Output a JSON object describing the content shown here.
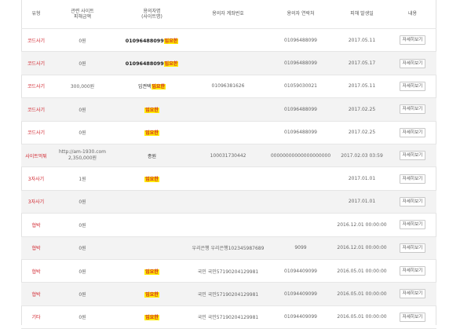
{
  "headers": {
    "type": "유형",
    "site_line1": "관련 사이트",
    "site_line2": "피해금액",
    "suspect_line1": "용의자명",
    "suspect_line2": "(사이트명)",
    "account": "용의자 계좌번호",
    "contact": "용의자 연락처",
    "date": "피해 발생일",
    "detail": "내용"
  },
  "detail_button": "자세히보기",
  "rows": [
    {
      "type": "코드사기",
      "site": "0원",
      "site_extra": "",
      "name": "01096488099",
      "name_mark": "임요한",
      "account": "",
      "contact": "01096488099",
      "date": "2017.05.11"
    },
    {
      "type": "코드사기",
      "site": "0원",
      "site_extra": "",
      "name": "01096488099",
      "name_mark": "임요한",
      "account": "",
      "contact": "01096488099",
      "date": "2017.05.17"
    },
    {
      "type": "코드사기",
      "site": "300,000원",
      "site_extra": "",
      "name": "임권택",
      "name_mark": "임요한",
      "account": "01096381626",
      "contact": "01059030021",
      "date": "2017.05.11"
    },
    {
      "type": "코드사기",
      "site": "0원",
      "site_extra": "",
      "name": "",
      "name_mark": "임요한",
      "account": "",
      "contact": "01096488099",
      "date": "2017.02.25"
    },
    {
      "type": "코드사기",
      "site": "0원",
      "site_extra": "",
      "name": "",
      "name_mark": "임요한",
      "account": "",
      "contact": "01096488099",
      "date": "2017.02.25"
    },
    {
      "type": "사이트먹튀",
      "site": "http://am-1930.com",
      "site_extra": "2,350,000원",
      "name": "종원",
      "name_mark": "",
      "account": "100031730442",
      "contact": "00000000000000000000",
      "date": "2017.02.03 03:59"
    },
    {
      "type": "3자사기",
      "site": "1원",
      "site_extra": "",
      "name": "",
      "name_mark": "임요한",
      "account": "",
      "contact": "",
      "date": "2017.01.01"
    },
    {
      "type": "3자사기",
      "site": "0원",
      "site_extra": "",
      "name": "",
      "name_mark": "",
      "account": "",
      "contact": "",
      "date": "2017.01.01"
    },
    {
      "type": "협박",
      "site": "0원",
      "site_extra": "",
      "name": "",
      "name_mark": "",
      "account": "",
      "contact": "",
      "date": "2016.12.01 00:00:00"
    },
    {
      "type": "협박",
      "site": "0원",
      "site_extra": "",
      "name": "",
      "name_mark": "",
      "account": "우리은행 우리은행102345987689",
      "contact": "9099",
      "date": "2016.12.01 00:00:00"
    },
    {
      "type": "협박",
      "site": "0원",
      "site_extra": "",
      "name": "",
      "name_mark": "임요한",
      "account": "국민 국민57190204129981",
      "contact": "01094409099",
      "date": "2016.05.01 00:00:00"
    },
    {
      "type": "협박",
      "site": "0원",
      "site_extra": "",
      "name": "",
      "name_mark": "임요한",
      "account": "국민 국민57190204129981",
      "contact": "01094409099",
      "date": "2016.05.01 00:00:00"
    },
    {
      "type": "기타",
      "site": "0원",
      "site_extra": "",
      "name": "",
      "name_mark": "임요한",
      "account": "국민 국민57190204129981",
      "contact": "01094409099",
      "date": "2016.05.01 00:00:00"
    }
  ]
}
